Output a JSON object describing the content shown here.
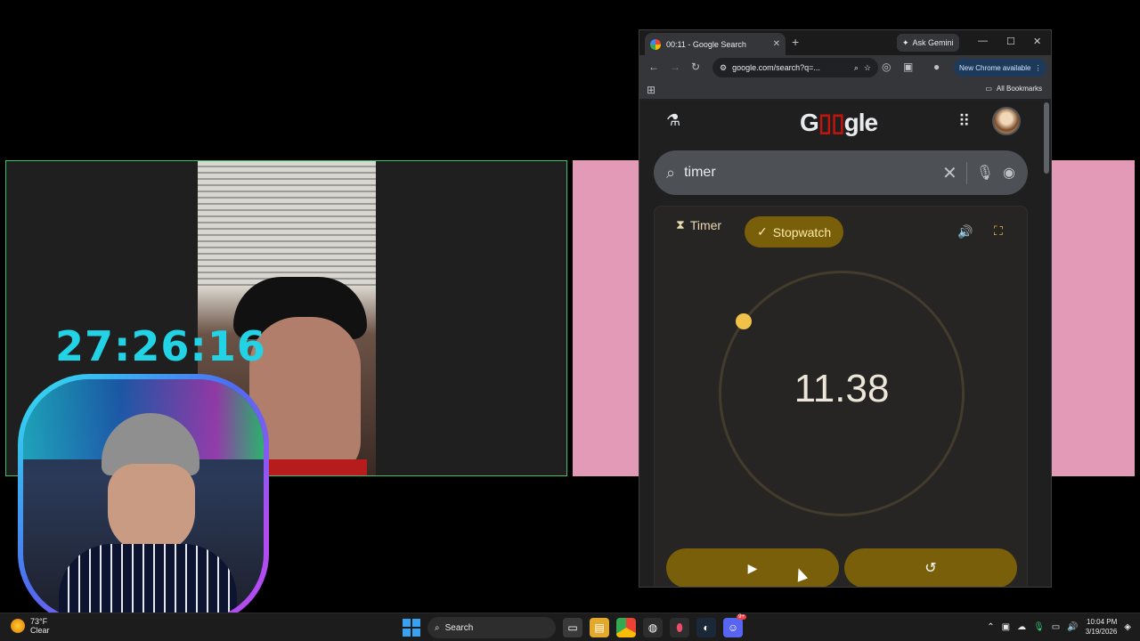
{
  "overlay": {
    "big_clock": "27:26:16"
  },
  "browser": {
    "tab_title": "00:11 - Google Search",
    "new_tab_symbol": "+",
    "ask_gemini": "Ask Gemini",
    "address": "google.com/search?q=...",
    "new_chrome": "New Chrome available",
    "bookmarks_label": "All Bookmarks"
  },
  "google": {
    "logo_g": "G",
    "logo_mid": "▯▯",
    "logo_end": "gle",
    "search_query": "timer"
  },
  "stopwatch": {
    "tab_timer": "Timer",
    "tab_stopwatch": "Stopwatch",
    "elapsed": "11.38",
    "accent_color": "#f1c14a",
    "button_color": "#7a5f0a"
  },
  "taskbar": {
    "weather_temp": "73°F",
    "weather_desc": "Clear",
    "search_label": "Search",
    "time": "10:04 PM",
    "date": "3/19/2026",
    "discord_badge": "9+"
  }
}
